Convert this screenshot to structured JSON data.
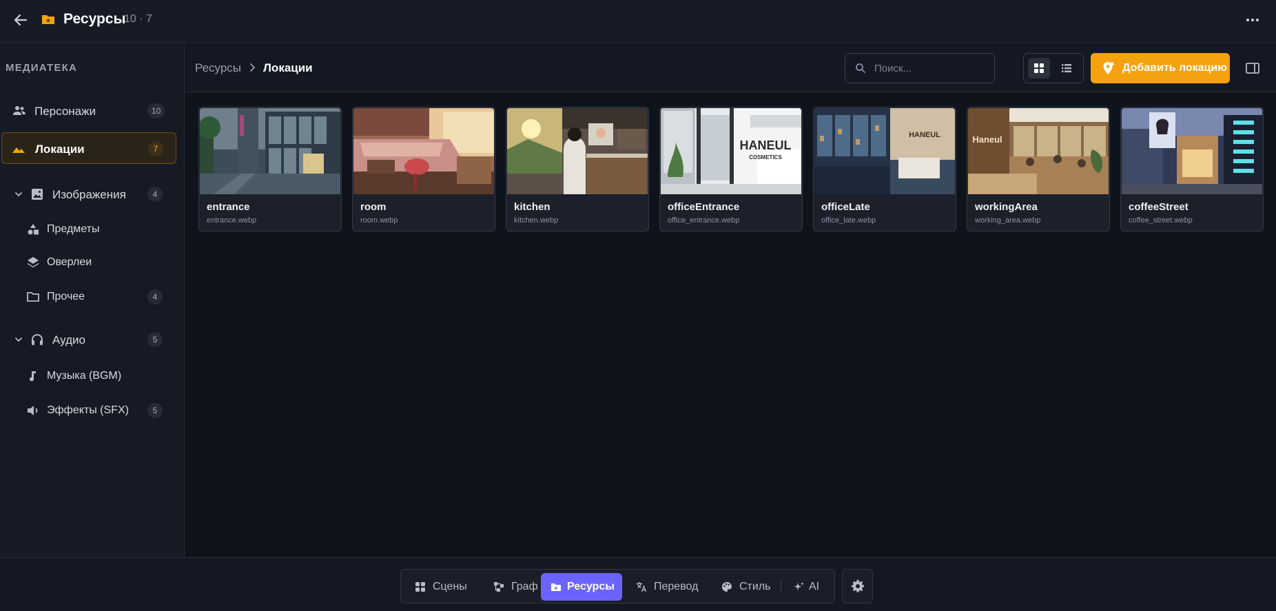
{
  "header": {
    "title": "Ресурсы",
    "counts": "10 · 7"
  },
  "sidebar": {
    "section_title": "МЕДИАТЕКА",
    "items": [
      {
        "label": "Персонажи",
        "count": "10",
        "icon": "users-icon"
      },
      {
        "label": "Локации",
        "count": "7",
        "icon": "landscape-icon",
        "active": true
      },
      {
        "label": "Изображения",
        "count": "4",
        "icon": "image-icon",
        "expanded": true
      },
      {
        "label": "Предметы",
        "count": "",
        "icon": "shapes-icon"
      },
      {
        "label": "Оверлеи",
        "count": "",
        "icon": "layers-icon"
      },
      {
        "label": "Прочее",
        "count": "4",
        "icon": "folder-icon"
      },
      {
        "label": "Аудио",
        "count": "5",
        "icon": "headphones-icon",
        "expanded": true
      },
      {
        "label": "Музыка (BGM)",
        "count": "",
        "icon": "music-note-icon"
      },
      {
        "label": "Эффекты (SFX)",
        "count": "5",
        "icon": "speaker-icon"
      }
    ]
  },
  "toolbar": {
    "breadcrumb_root": "Ресурсы",
    "breadcrumb_current": "Локации",
    "search_placeholder": "Поиск...",
    "view_mode": "grid",
    "add_label": "Добавить локацию"
  },
  "cards": [
    {
      "name": "entrance",
      "file": "entrance.webp"
    },
    {
      "name": "room",
      "file": "room.webp"
    },
    {
      "name": "kitchen",
      "file": "kitchen.webp"
    },
    {
      "name": "officeEntrance",
      "file": "office_entrance.webp",
      "sign": "HANEUL",
      "sign_sub": "COSMETICS"
    },
    {
      "name": "officeLate",
      "file": "office_late.webp",
      "sign": "HANEUL"
    },
    {
      "name": "workingArea",
      "file": "working_area.webp",
      "sign": "Haneul"
    },
    {
      "name": "coffeeStreet",
      "file": "coffee_street.webp"
    }
  ],
  "bottom_tabs": [
    {
      "label": "Сцены",
      "icon": "grid-icon"
    },
    {
      "label": "Граф",
      "icon": "graph-icon"
    },
    {
      "label": "Ресурсы",
      "icon": "folder-icon",
      "active": true
    },
    {
      "label": "Перевод",
      "icon": "translate-icon"
    },
    {
      "label": "Стиль",
      "icon": "palette-icon"
    },
    {
      "label": "AI",
      "icon": "sparkle-icon"
    }
  ],
  "colors": {
    "accent": "#f5a20f",
    "active_tab": "#6c63ff",
    "background": "#0f131c"
  }
}
